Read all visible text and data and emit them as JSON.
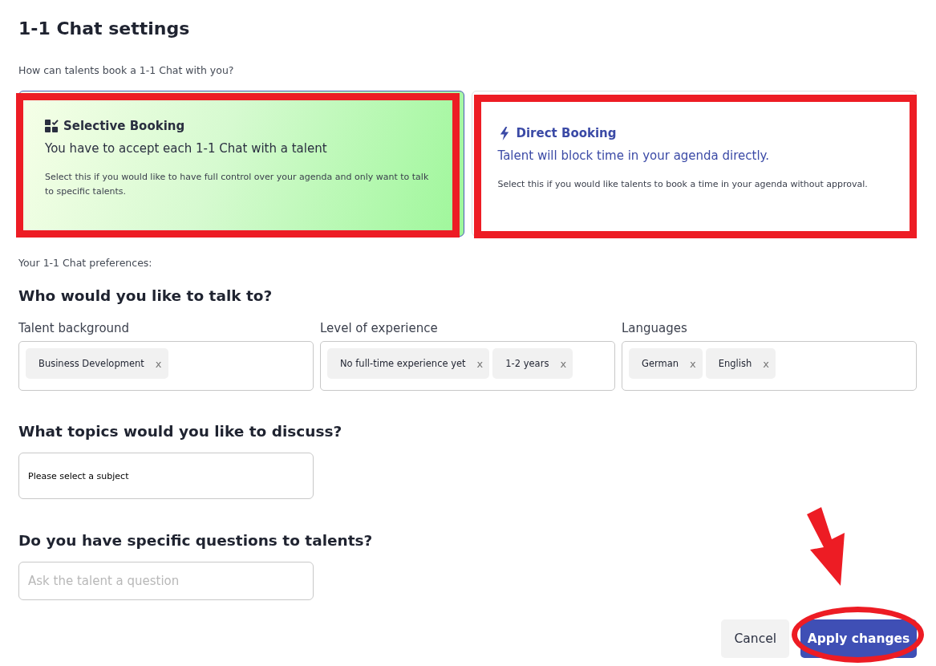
{
  "page": {
    "title": "1-1 Chat settings"
  },
  "booking": {
    "question": "How can talents book a 1-1 Chat with you?",
    "options": [
      {
        "kind": "selective",
        "title": "Selective Booking",
        "subtitle": "You have to accept each 1-1 Chat with a talent",
        "description": "Select this if you would like to have full control over your agenda and only want to talk to specific talents.",
        "selected": true,
        "highlighted": true
      },
      {
        "kind": "direct",
        "title": "Direct Booking",
        "subtitle": "Talent will block time in your agenda directly.",
        "description": "Select this if you would like talents to book a time in your agenda without approval.",
        "selected": false,
        "highlighted": true
      }
    ]
  },
  "preferences": {
    "label": "Your 1-1 Chat preferences:",
    "heading": "Who would you like to talk to?",
    "filters": [
      {
        "label": "Talent background",
        "tags": [
          {
            "text": "Business Development",
            "remove": "x"
          }
        ]
      },
      {
        "label": "Level of experience",
        "tags": [
          {
            "text": "No full-time experience yet",
            "remove": "x"
          },
          {
            "text": "1-2 years",
            "remove": "x"
          }
        ]
      },
      {
        "label": "Languages",
        "tags": [
          {
            "text": "German",
            "remove": "x"
          },
          {
            "text": "English",
            "remove": "x"
          }
        ]
      }
    ]
  },
  "topics": {
    "heading": "What topics would you like to discuss?",
    "field": {
      "value": "Please select a subject"
    }
  },
  "questions": {
    "heading": "Do you have specific questions to talents?",
    "field": {
      "placeholder": "Ask the talent a question"
    }
  },
  "actions": [
    {
      "kind": "secondary",
      "label": "Cancel",
      "circled": false,
      "arrow": false
    },
    {
      "kind": "primary",
      "label": "Apply changes",
      "circled": true,
      "arrow": true
    }
  ]
}
